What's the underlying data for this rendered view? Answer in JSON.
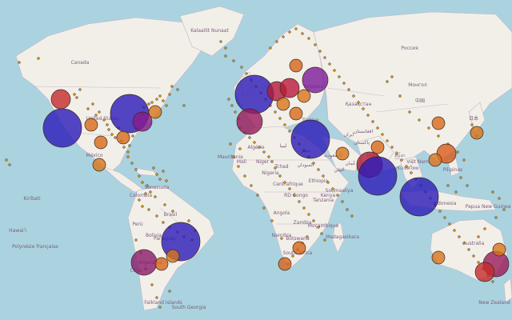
{
  "map": {
    "colors": {
      "ocean": "#aad3df",
      "land": "#f2efe9",
      "border": "#c7b3c7",
      "tiny_marker": "#e0a020",
      "marker_stroke": "#3a2a1a"
    },
    "country_labels": [
      {
        "id": "canada",
        "text": "Canada"
      },
      {
        "id": "russia",
        "text": "Россия"
      },
      {
        "id": "kazakhstan",
        "text": "Қазақстан"
      },
      {
        "id": "china",
        "text": "中国"
      },
      {
        "id": "india",
        "text": "India"
      },
      {
        "id": "brasil",
        "text": "Brasil"
      },
      {
        "id": "australia",
        "text": "Australia"
      },
      {
        "id": "argentina",
        "text": "Argentina"
      },
      {
        "id": "nigeria",
        "text": "Nigeria"
      },
      {
        "id": "ethiopia",
        "text": "Ethiopia"
      },
      {
        "id": "algerie",
        "text": "Algérie"
      },
      {
        "id": "libya",
        "text": "ليبيا"
      },
      {
        "id": "mali",
        "text": "Mali"
      },
      {
        "id": "niger",
        "text": "Niger"
      },
      {
        "id": "tchad",
        "text": "Tchad"
      },
      {
        "id": "sudan",
        "text": "السودان"
      },
      {
        "id": "egypt",
        "text": "مصر"
      },
      {
        "id": "saudi",
        "text": "السعودية"
      },
      {
        "id": "iran",
        "text": "ایران"
      },
      {
        "id": "mongolia",
        "text": "Монгол"
      },
      {
        "id": "indonesia",
        "text": "Indonesia"
      },
      {
        "id": "peru",
        "text": "Perú"
      },
      {
        "id": "bolivia",
        "text": "Bolivia"
      },
      {
        "id": "colombia",
        "text": "Colombia"
      },
      {
        "id": "venezuela",
        "text": "Venezuela"
      },
      {
        "id": "mexico",
        "text": "México"
      },
      {
        "id": "usa",
        "text": "United States"
      },
      {
        "id": "greenland",
        "text": "Kalaallit Nunaat"
      },
      {
        "id": "angola",
        "text": "Angola"
      },
      {
        "id": "namibia",
        "text": "Namibia"
      },
      {
        "id": "south_africa",
        "text": "South Africa"
      },
      {
        "id": "madagascar",
        "text": "Madagasikara"
      },
      {
        "id": "tanzania",
        "text": "Tanzania"
      },
      {
        "id": "congo",
        "text": "RD Congo"
      },
      {
        "id": "centrafrique",
        "text": "Centrafrique"
      },
      {
        "id": "pakistan",
        "text": "پاکستان"
      },
      {
        "id": "myanmar",
        "text": "မြန်မာ"
      },
      {
        "id": "thailand",
        "text": "ประเทศไทย"
      },
      {
        "id": "png",
        "text": "Papua New Guinea"
      },
      {
        "id": "nz",
        "text": "New Zealand"
      },
      {
        "id": "chile",
        "text": "Chile"
      },
      {
        "id": "paraguay",
        "text": "Paraguay"
      },
      {
        "id": "hawaii",
        "text": "Hawai'i"
      },
      {
        "id": "falkland",
        "text": "Falkland Islands"
      },
      {
        "id": "kiribati",
        "text": "Kiribati"
      },
      {
        "id": "polynesie",
        "text": "Polynésie française"
      },
      {
        "id": "georgia",
        "text": "South Georgia"
      },
      {
        "id": "mauritanie",
        "text": "Mauritanie"
      },
      {
        "id": "yemen",
        "text": "اليمن"
      },
      {
        "id": "afghanistan",
        "text": "افغانستان"
      },
      {
        "id": "turkey",
        "text": "Türkiye"
      },
      {
        "id": "ukraine",
        "text": "Україна"
      },
      {
        "id": "japan",
        "text": "日本"
      },
      {
        "id": "philippines",
        "text": "Pilipinas"
      },
      {
        "id": "vietnam",
        "text": "Việt Nam"
      },
      {
        "id": "somalia",
        "text": "Soomaaliya"
      },
      {
        "id": "kenya",
        "text": "Kenya"
      },
      {
        "id": "zambia",
        "text": "Zambia"
      },
      {
        "id": "mozambique",
        "text": "Moçambique"
      },
      {
        "id": "botswana",
        "text": "Botswana"
      },
      {
        "id": "oman",
        "text": "عُمان"
      }
    ],
    "bubbles": [
      {
        "id": "san-francisco",
        "size": "xl",
        "color": "#2a1ab8"
      },
      {
        "id": "seattle-vancouver",
        "size": "m",
        "color": "#c42a2a"
      },
      {
        "id": "chicago",
        "size": "s",
        "color": "#d86a1a"
      },
      {
        "id": "new-york",
        "size": "xl",
        "color": "#2a1ab8"
      },
      {
        "id": "boston",
        "size": "m",
        "color": "#8a1a8a"
      },
      {
        "id": "toronto",
        "size": "s",
        "color": "#d8741a"
      },
      {
        "id": "atlanta",
        "size": "s",
        "color": "#d86a1a"
      },
      {
        "id": "houston",
        "size": "s",
        "color": "#d8741a"
      },
      {
        "id": "mexico-city",
        "size": "s",
        "color": "#d86a1a"
      },
      {
        "id": "london",
        "size": "xl",
        "color": "#2a1ab8"
      },
      {
        "id": "paris",
        "size": "l",
        "color": "#9a1a5a"
      },
      {
        "id": "amsterdam",
        "size": "m",
        "color": "#b01a3a"
      },
      {
        "id": "berlin",
        "size": "m",
        "color": "#b81a3a"
      },
      {
        "id": "stockholm",
        "size": "s",
        "color": "#d8641a"
      },
      {
        "id": "moscow",
        "size": "l",
        "color": "#7a1a9a"
      },
      {
        "id": "zurich",
        "size": "s",
        "color": "#d86a1a"
      },
      {
        "id": "madrid",
        "size": "s",
        "color": "#d8741a"
      },
      {
        "id": "rome",
        "size": "s",
        "color": "#d8741a"
      },
      {
        "id": "tel-aviv",
        "size": "xl",
        "color": "#2a1ab8"
      },
      {
        "id": "dubai",
        "size": "s",
        "color": "#d8741a"
      },
      {
        "id": "delhi",
        "size": "s",
        "color": "#d86a1a"
      },
      {
        "id": "mumbai",
        "size": "l",
        "color": "#b01a3a"
      },
      {
        "id": "bangalore",
        "size": "xl",
        "color": "#2a1ab8"
      },
      {
        "id": "singapore",
        "size": "xl",
        "color": "#2a1ab8"
      },
      {
        "id": "beijing",
        "size": "s",
        "color": "#d86a1a"
      },
      {
        "id": "hong-kong",
        "size": "m",
        "color": "#d85a1a"
      },
      {
        "id": "tokyo",
        "size": "s",
        "color": "#d8741a"
      },
      {
        "id": "taipei",
        "size": "s",
        "color": "#d8741a"
      },
      {
        "id": "sao-paulo",
        "size": "xl",
        "color": "#2a1ab8"
      },
      {
        "id": "buenos-aires",
        "size": "l",
        "color": "#8a1a6a"
      },
      {
        "id": "montevideo",
        "size": "s",
        "color": "#d8641a"
      },
      {
        "id": "santiago",
        "size": "s",
        "color": "#d8741a"
      },
      {
        "id": "cape-town",
        "size": "s",
        "color": "#d8641a"
      },
      {
        "id": "johannesburg",
        "size": "s",
        "color": "#d8641a"
      },
      {
        "id": "sydney",
        "size": "l",
        "color": "#9a1a5a"
      },
      {
        "id": "melbourne",
        "size": "m",
        "color": "#c42a2a"
      },
      {
        "id": "perth",
        "size": "s",
        "color": "#d8741a"
      },
      {
        "id": "brisbane",
        "size": "s",
        "color": "#d8741a"
      }
    ]
  }
}
